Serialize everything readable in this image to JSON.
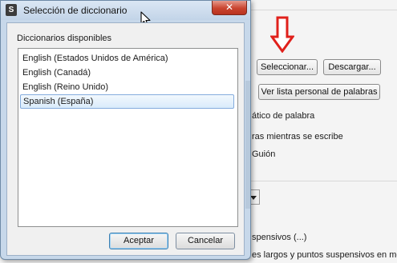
{
  "dialog": {
    "title": "Selección de diccionario",
    "app_icon_glyph": "S",
    "close_glyph": "✕",
    "list_label": "Diccionarios disponibles",
    "items": [
      {
        "label": "English (Estados Unidos de América)"
      },
      {
        "label": "English (Canadá)"
      },
      {
        "label": "English (Reino Unido)"
      },
      {
        "label": "Spanish (España)"
      }
    ],
    "selected_item": "Spanish (España)",
    "accept_label": "Aceptar",
    "cancel_label": "Cancelar"
  },
  "background": {
    "select_button": "Seleccionar...",
    "download_button": "Descargar...",
    "wordlist_button": "Ver lista personal de palabras",
    "grammar_text": "ático de palabra",
    "typing_text": "ras mientras se escribe",
    "hyphen_text": "Guión",
    "ellipsis_text": "spensivos (...)",
    "long_text": "es largos y puntos suspensivos en mo"
  },
  "annotation": {
    "arrow_color": "#e0201b",
    "arrow_icon": "down-arrow-icon"
  },
  "icons": {
    "cursor": "mouse-pointer-icon",
    "dropdown": "chevron-down-icon"
  }
}
